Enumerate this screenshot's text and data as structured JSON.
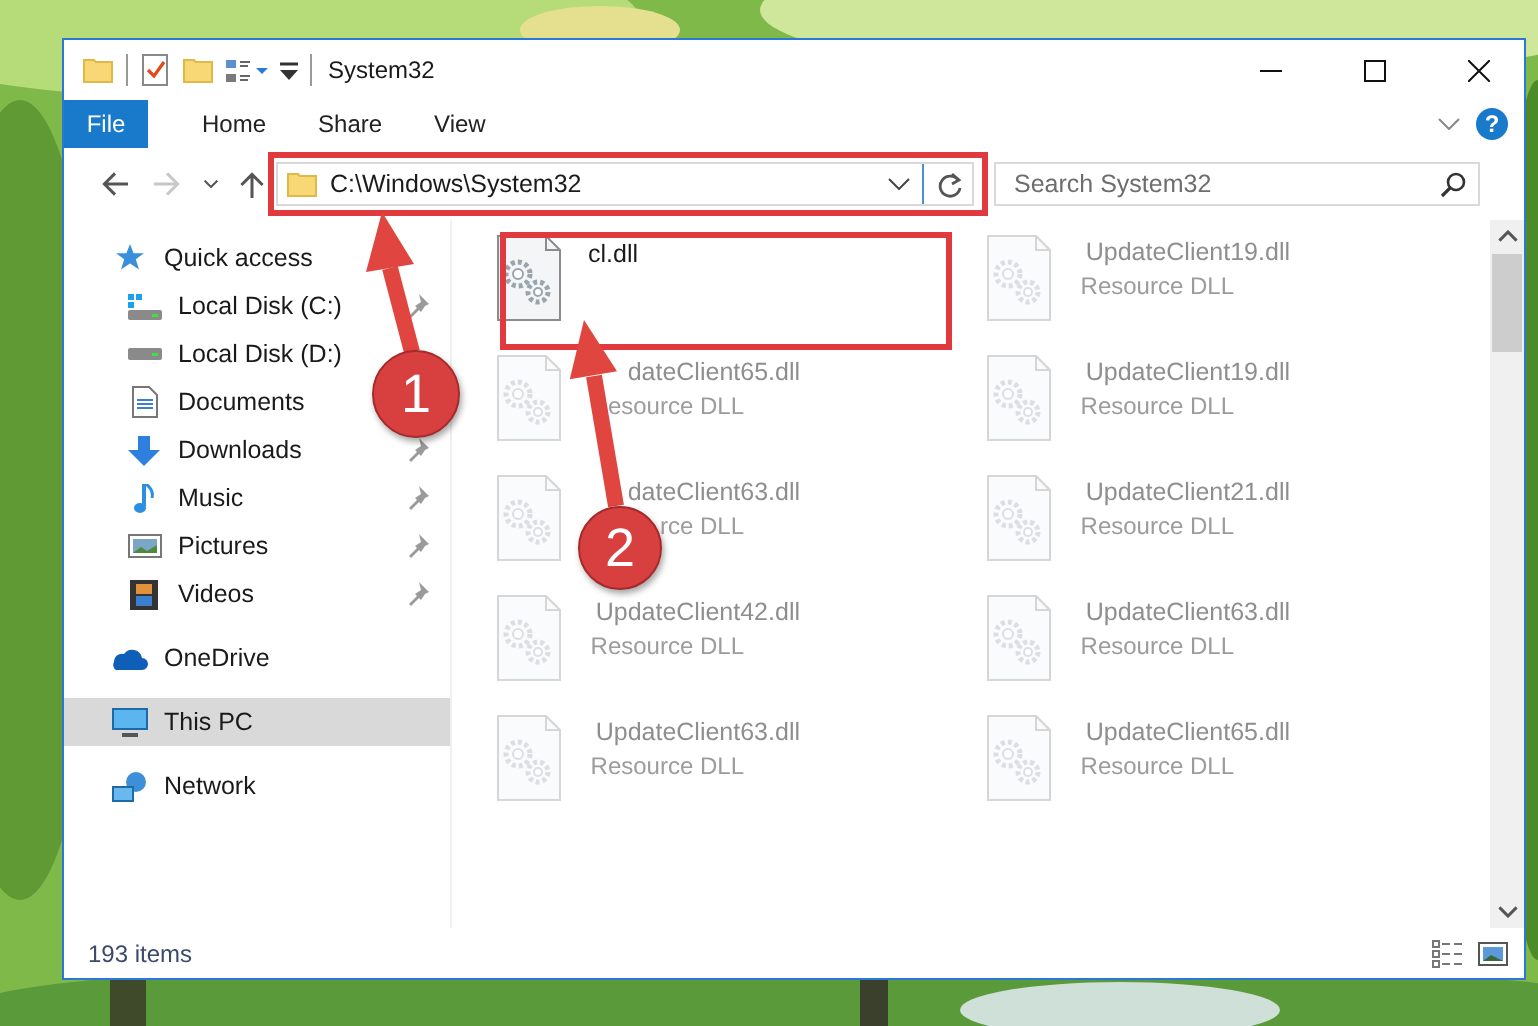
{
  "window": {
    "title": "System32"
  },
  "ribbon": {
    "tabs": [
      {
        "label": "File",
        "kind": "file"
      },
      {
        "label": "Home",
        "kind": "tab"
      },
      {
        "label": "Share",
        "kind": "tab"
      },
      {
        "label": "View",
        "kind": "tab"
      }
    ],
    "help_label": "?"
  },
  "address_bar": {
    "path": "C:\\Windows\\System32"
  },
  "search": {
    "placeholder": "Search System32"
  },
  "sidebar": {
    "items": [
      {
        "label": "Quick access",
        "selected": false,
        "children": [
          {
            "label": "Local Disk (C:)",
            "pinned": true,
            "selected": false
          },
          {
            "label": "Local Disk (D:)",
            "pinned": false,
            "selected": false
          },
          {
            "label": "Documents",
            "pinned": false,
            "selected": false
          },
          {
            "label": "Downloads",
            "pinned": true,
            "selected": false
          },
          {
            "label": "Music",
            "pinned": true,
            "selected": false
          },
          {
            "label": "Pictures",
            "pinned": true,
            "selected": false
          },
          {
            "label": "Videos",
            "pinned": true,
            "selected": false
          }
        ]
      },
      {
        "label": "OneDrive",
        "selected": false
      },
      {
        "label": "This PC",
        "selected": true
      },
      {
        "label": "Network",
        "selected": false
      }
    ]
  },
  "files": [
    {
      "name": "cl.dll",
      "blurred": false
    },
    {
      "name": "UpdateClient19.dll",
      "type": "Resource DLL",
      "blurred": true
    },
    {
      "name": "dateClient65.dll",
      "type": "esource DLL",
      "blurred": true
    },
    {
      "name": "UpdateClient19.dll",
      "type": "Resource DLL",
      "blurred": true
    },
    {
      "name": "dateClient63.dll",
      "type": "rce DLL",
      "blurred": true
    },
    {
      "name": "UpdateClient21.dll",
      "type": "Resource DLL",
      "blurred": true
    },
    {
      "name": "UpdateClient42.dll",
      "type": "Resource DLL",
      "blurred": true
    },
    {
      "name": "UpdateClient63.dll",
      "type": "Resource DLL",
      "blurred": true
    },
    {
      "name": "UpdateClient63.dll",
      "type": "Resource DLL",
      "blurred": true
    },
    {
      "name": "UpdateClient65.dll",
      "type": "Resource DLL",
      "blurred": true
    }
  ],
  "status_bar": {
    "count": "193 items"
  },
  "callouts": [
    {
      "number": "1"
    },
    {
      "number": "2"
    }
  ]
}
